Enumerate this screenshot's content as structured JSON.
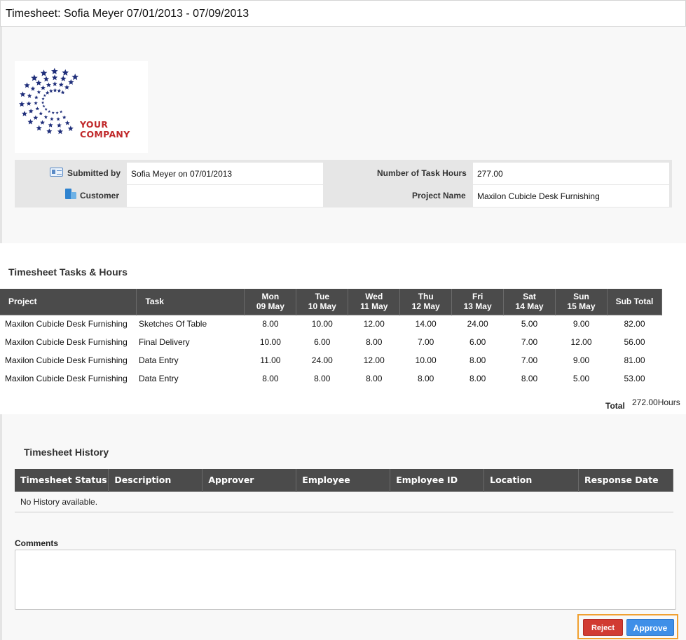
{
  "title": "Timesheet: Sofia Meyer 07/01/2013 - 07/09/2013",
  "logo": {
    "line1": "YOUR",
    "line2": "COMPANY",
    "brand_color": "#c0282a",
    "star_color": "#1f2e7a"
  },
  "info": {
    "submitted_by_label": "Submitted by",
    "submitted_by_value": "Sofia Meyer on 07/01/2013",
    "customer_label": "Customer",
    "customer_value": "",
    "task_hours_label": "Number of Task Hours",
    "task_hours_value": "277.00",
    "project_name_label": "Project Name",
    "project_name_value": "Maxilon Cubicle Desk Furnishing"
  },
  "tasks": {
    "title": "Timesheet Tasks & Hours",
    "col_project": "Project",
    "col_task": "Task",
    "days": [
      {
        "name": "Mon",
        "date": "09 May"
      },
      {
        "name": "Tue",
        "date": "10 May"
      },
      {
        "name": "Wed",
        "date": "11 May"
      },
      {
        "name": "Thu",
        "date": "12 May"
      },
      {
        "name": "Fri",
        "date": "13 May"
      },
      {
        "name": "Sat",
        "date": "14 May"
      },
      {
        "name": "Sun",
        "date": "15 May"
      }
    ],
    "col_subtotal": "Sub Total",
    "rows": [
      {
        "project": "Maxilon Cubicle Desk Furnishing",
        "task": "Sketches Of Table",
        "hours": [
          "8.00",
          "10.00",
          "12.00",
          "14.00",
          "24.00",
          "5.00",
          "9.00"
        ],
        "subtotal": "82.00"
      },
      {
        "project": "Maxilon Cubicle Desk Furnishing",
        "task": "Final Delivery",
        "hours": [
          "10.00",
          "6.00",
          "8.00",
          "7.00",
          "6.00",
          "7.00",
          "12.00"
        ],
        "subtotal": "56.00"
      },
      {
        "project": "Maxilon Cubicle Desk Furnishing",
        "task": "Data Entry",
        "hours": [
          "11.00",
          "24.00",
          "12.00",
          "10.00",
          "8.00",
          "7.00",
          "9.00"
        ],
        "subtotal": "81.00"
      },
      {
        "project": "Maxilon Cubicle Desk Furnishing",
        "task": "Data Entry",
        "hours": [
          "8.00",
          "8.00",
          "8.00",
          "8.00",
          "8.00",
          "8.00",
          "5.00"
        ],
        "subtotal": "53.00"
      }
    ],
    "total_label": "Total",
    "total_value": "272.00Hours"
  },
  "history": {
    "title": "Timesheet History",
    "columns": [
      "Timesheet Status",
      "Description",
      "Approver",
      "Employee",
      "Employee ID",
      "Location",
      "Response Date"
    ],
    "empty_message": "No History available."
  },
  "comments": {
    "label": "Comments",
    "value": ""
  },
  "actions": {
    "reject_label": "Reject",
    "approve_label": "Approve",
    "reject_color": "#d13b32",
    "approve_color": "#3f8fe8"
  }
}
